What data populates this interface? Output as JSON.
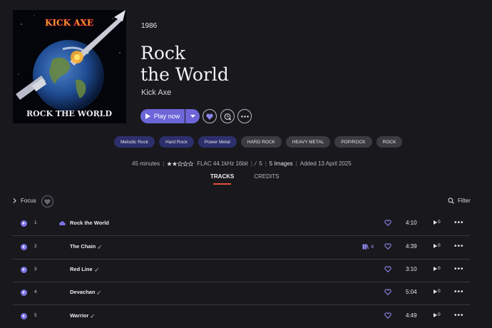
{
  "cover": {
    "band": "KICK AXE",
    "album": "ROCK THE WORLD"
  },
  "album": {
    "year": "1986",
    "title_line1": "Rock",
    "title_line2": "the World",
    "artist": "Kick Axe"
  },
  "actions": {
    "play_label": "Play now"
  },
  "genres": [
    {
      "label": "Melodic Rock",
      "style": "primary"
    },
    {
      "label": "Hard Rock",
      "style": "primary"
    },
    {
      "label": "Power Metal",
      "style": "primary"
    },
    {
      "label": "HARD ROCK",
      "style": "secondary"
    },
    {
      "label": "HEAVY METAL",
      "style": "secondary"
    },
    {
      "label": "POP/ROCK",
      "style": "secondary"
    },
    {
      "label": "ROCK",
      "style": "secondary"
    }
  ],
  "meta": {
    "duration": "45 minutes",
    "rating_stars": 2.5,
    "format": "FLAC 44.1kHz 16bit",
    "volume": "5",
    "images": "5 Images",
    "added": "Added 13 April 2025"
  },
  "tabs": {
    "tracks": "TRACKS",
    "credits": "CREDITS"
  },
  "toolbar": {
    "focus": "Focus",
    "filter": "Filter"
  },
  "tracks": [
    {
      "num": "1",
      "title": "Rock the World",
      "duration": "4:10",
      "plays": "0",
      "versions": ""
    },
    {
      "num": "2",
      "title": "The Chain",
      "duration": "4:39",
      "plays": "0",
      "versions": "4"
    },
    {
      "num": "3",
      "title": "Red Line",
      "duration": "3:10",
      "plays": "0",
      "versions": ""
    },
    {
      "num": "4",
      "title": "Devachan",
      "duration": "5:04",
      "plays": "0",
      "versions": ""
    },
    {
      "num": "5",
      "title": "Warrior",
      "duration": "4:49",
      "plays": "0",
      "versions": ""
    }
  ],
  "colors": {
    "accent": "#6d66d8",
    "background": "#19181c",
    "tab_underline": "#e0503a"
  }
}
